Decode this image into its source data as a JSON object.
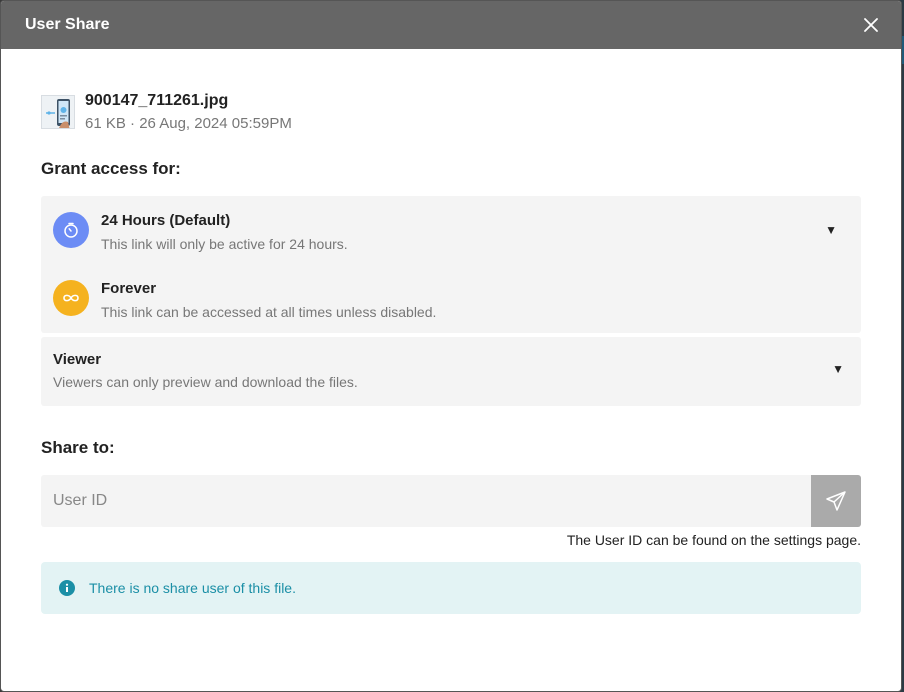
{
  "dialog": {
    "title": "User Share"
  },
  "file": {
    "name": "900147_711261.jpg",
    "meta": "61 KB · 26 Aug, 2024 05:59PM"
  },
  "grant": {
    "title": "Grant access for:",
    "options": [
      {
        "label": "24 Hours (Default)",
        "description": "This link will only be active for 24 hours.",
        "icon": "timer-icon",
        "color": "#6c8cf5"
      },
      {
        "label": "Forever",
        "description": "This link can be accessed at all times unless disabled.",
        "icon": "infinity-icon",
        "color": "#f5b21f"
      }
    ]
  },
  "role": {
    "label": "Viewer",
    "description": "Viewers can only preview and download the files."
  },
  "share": {
    "title": "Share to:",
    "placeholder": "User ID",
    "hint": "The User ID can be found on the settings page."
  },
  "info": {
    "message": "There is no share user of this file.",
    "color": "#1b8fa6"
  }
}
